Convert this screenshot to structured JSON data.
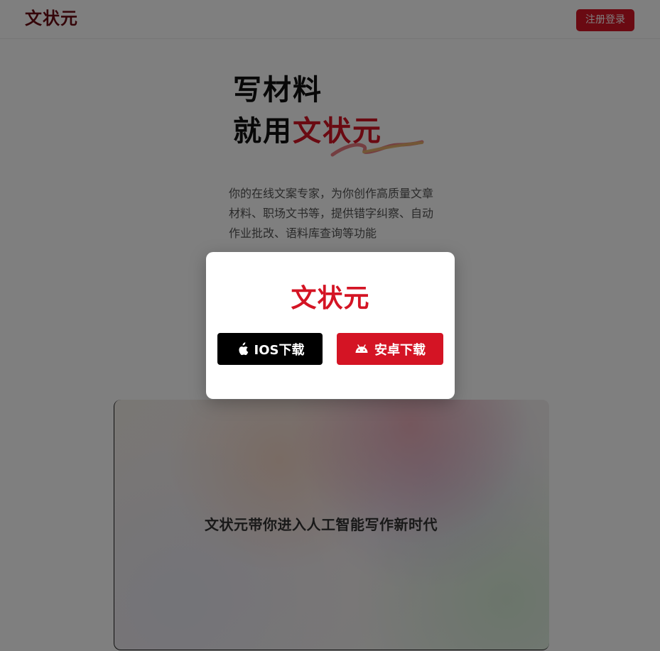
{
  "colors": {
    "brand": "#d41424",
    "brand_dim": "#6b0a12",
    "stroke_gold": "#e4b86a",
    "stroke_red": "#e25058",
    "ios_button": "#000000",
    "android_button": "#d41424",
    "overlay": "rgba(0,0,0,0.5)"
  },
  "header": {
    "logo": "文状元",
    "login_button": "注册登录"
  },
  "hero": {
    "title_line1": "写材料",
    "title_line2_prefix": "就用",
    "title_line2_brand": "文状元",
    "description": "你的在线文案专家，为你创作高质量文章材料、职场文书等，提供错字纠察、自动作业批改、语料库查询等功能"
  },
  "video_card": {
    "caption": "文状元带你进入人工智能写作新时代"
  },
  "modal": {
    "logo": "文状元",
    "ios_button": {
      "label": "IOS下载",
      "icon": "apple-icon"
    },
    "android_button": {
      "label": "安卓下载",
      "icon": "android-icon"
    }
  }
}
